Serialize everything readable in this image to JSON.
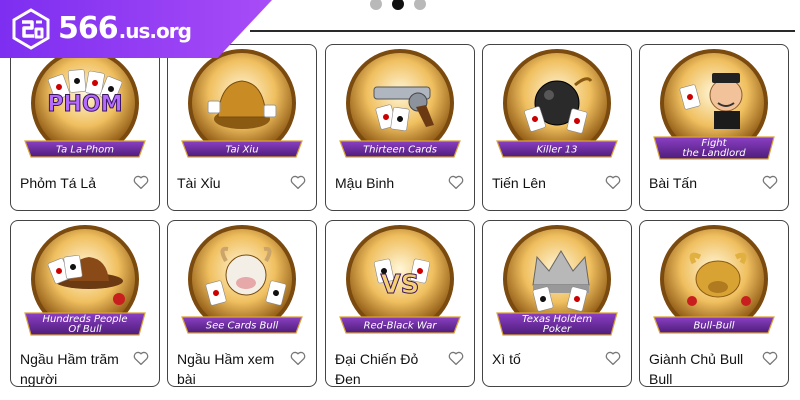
{
  "brand": {
    "number": "566",
    "domain": ".us.org"
  },
  "pager": {
    "count": 3,
    "active_index": 1
  },
  "games": [
    {
      "name": "Phỏm Tá Lả",
      "art_caption": [
        "Ta La-Phom"
      ],
      "art_logo": "PHOM",
      "icon": "phom-cards-icon"
    },
    {
      "name": "Tài Xỉu",
      "art_caption": [
        "Tai Xiu"
      ],
      "icon": "dice-cup-icon"
    },
    {
      "name": "Mậu Binh",
      "art_caption": [
        "Thirteen Cards"
      ],
      "icon": "revolver-icon"
    },
    {
      "name": "Tiến Lên",
      "art_caption": [
        "Killer 13"
      ],
      "icon": "bomb-icon"
    },
    {
      "name": "Bài Tấn",
      "art_caption": [
        "Fight",
        "the Landlord"
      ],
      "icon": "landlord-icon"
    },
    {
      "name": "Ngầu Hầm trăm người",
      "art_caption": [
        "Hundreds People",
        "Of Bull"
      ],
      "icon": "cowboy-hat-icon"
    },
    {
      "name": "Ngầu Hầm xem bài",
      "art_caption": [
        "See Cards Bull"
      ],
      "icon": "bull-mascot-icon"
    },
    {
      "name": "Đại Chiến Đỏ Đen",
      "art_caption": [
        "Red-Black War"
      ],
      "art_logo": "VS",
      "icon": "versus-icon"
    },
    {
      "name": "Xì tố",
      "art_caption": [
        "Texas Holdem",
        "Poker"
      ],
      "icon": "crown-icon"
    },
    {
      "name": "Giành Chủ Bull Bull",
      "art_caption": [
        "Bull-Bull"
      ],
      "icon": "golden-bull-icon"
    }
  ],
  "colors": {
    "brand_purple": "#8b35f2",
    "ribbon_purple": "#6b2a9e",
    "gold": "#d9a334",
    "card_border": "#444444"
  }
}
